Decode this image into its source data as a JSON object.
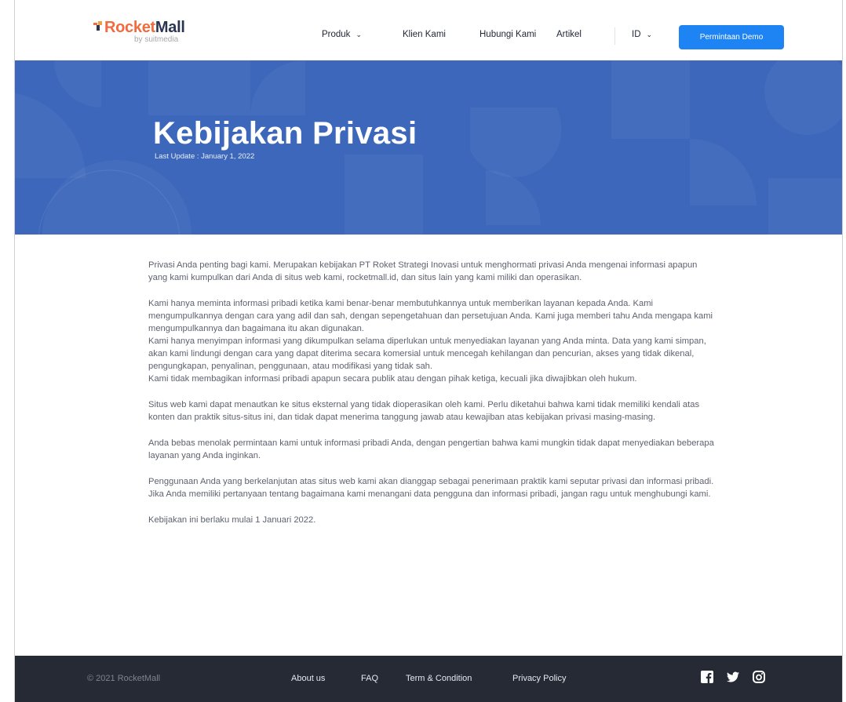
{
  "brand": {
    "name_part1": "Rocket",
    "name_part2": "Mall",
    "tagline": "by suitmedia",
    "colors": {
      "rocket": "#f06b3f",
      "mall": "#2b3550"
    }
  },
  "nav": {
    "items": [
      {
        "label": "Produk",
        "has_dropdown": true
      },
      {
        "label": "Klien Kami",
        "has_dropdown": false
      },
      {
        "label": "Hubungi Kami",
        "has_dropdown": false
      },
      {
        "label": "Artikel",
        "has_dropdown": false
      }
    ],
    "language": "ID",
    "demo_button": "Permintaan Demo"
  },
  "hero": {
    "title": "Kebijakan Privasi",
    "subtitle": "Last Update : January 1, 2022",
    "bg_color": "#3c67bb"
  },
  "content": {
    "paragraphs": [
      [
        "Privasi Anda penting bagi kami. Merupakan kebijakan PT Roket Strategi Inovasi untuk menghormati privasi Anda mengenai informasi apapun yang kami kumpulkan dari Anda di situs web kami, rocketmall.id, dan situs lain yang kami miliki dan operasikan."
      ],
      [
        "Kami hanya meminta informasi pribadi ketika kami benar-benar membutuhkannya untuk memberikan layanan kepada Anda. Kami mengumpulkannya dengan cara yang adil dan sah, dengan sepengetahuan dan persetujuan Anda. Kami juga memberi tahu Anda mengapa kami mengumpulkannya dan bagaimana itu akan digunakan.",
        "Kami hanya menyimpan informasi yang dikumpulkan selama diperlukan untuk menyediakan layanan yang Anda minta. Data yang kami simpan, akan kami lindungi dengan cara yang dapat diterima secara komersial untuk mencegah kehilangan dan pencurian, akses yang tidak dikenal, pengungkapan, penyalinan, penggunaan, atau modifikasi yang tidak sah.",
        "Kami tidak membagikan informasi pribadi apapun secara publik atau dengan pihak ketiga, kecuali jika diwajibkan oleh hukum."
      ],
      [
        "Situs web kami dapat menautkan ke situs eksternal yang tidak dioperasikan oleh kami. Perlu diketahui bahwa kami tidak memiliki kendali atas konten dan praktik situs-situs ini, dan tidak dapat menerima tanggung jawab atau kewajiban atas kebijakan privasi masing-masing."
      ],
      [
        "Anda bebas menolak permintaan kami untuk informasi pribadi Anda, dengan pengertian bahwa kami mungkin tidak dapat menyediakan beberapa layanan yang Anda inginkan."
      ],
      [
        "Penggunaan Anda yang berkelanjutan atas situs web kami akan dianggap sebagai penerimaan praktik kami seputar privasi dan informasi pribadi. Jika Anda memiliki pertanyaan tentang bagaimana kami menangani data pengguna dan informasi pribadi, jangan ragu untuk menghubungi kami."
      ],
      [
        "Kebijakan ini berlaku mulai 1 Januari 2022."
      ]
    ]
  },
  "footer": {
    "copyright": "© 2021 RocketMall",
    "links": [
      "About us",
      "FAQ",
      "Term & Condition",
      "Privacy Policy"
    ],
    "social_icons": [
      "facebook-icon",
      "twitter-icon",
      "instagram-icon"
    ],
    "bg_color": "#252a35"
  }
}
